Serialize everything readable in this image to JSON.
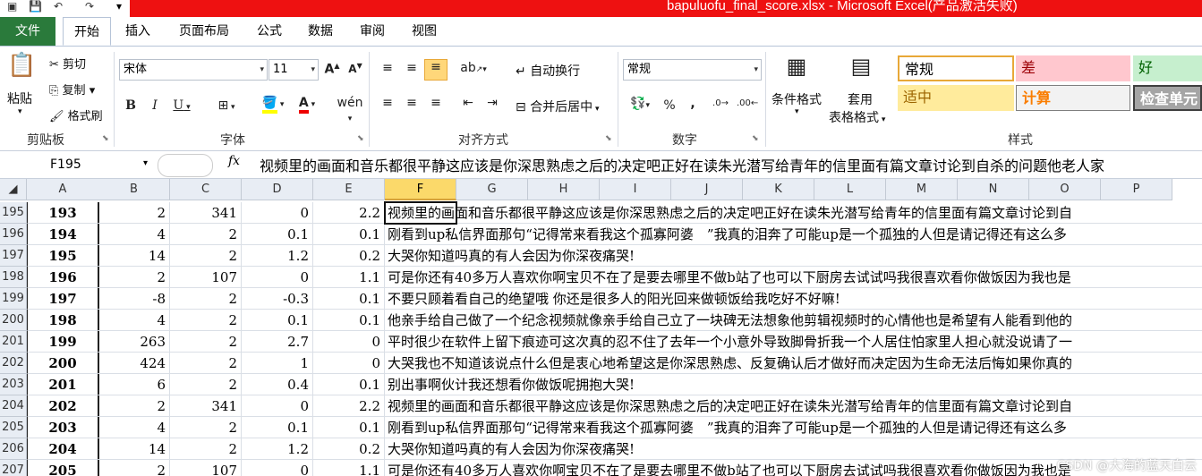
{
  "window": {
    "title": "bapuluofu_final_score.xlsx - Microsoft Excel(产品激活失败)"
  },
  "ribbon_tabs": [
    "文件",
    "开始",
    "插入",
    "页面布局",
    "公式",
    "数据",
    "审阅",
    "视图"
  ],
  "active_tab": "开始",
  "clipboard": {
    "paste": "粘贴",
    "cut": "剪切",
    "copy": "复制",
    "format_painter": "格式刷",
    "label": "剪贴板"
  },
  "font": {
    "name": "宋体",
    "size": "11",
    "label": "字体"
  },
  "alignment": {
    "wrap": "自动换行",
    "merge": "合并后居中",
    "label": "对齐方式"
  },
  "number": {
    "format": "常规",
    "percent": "%",
    "comma": ",",
    "label": "数字"
  },
  "styles": {
    "conditional": "条件格式",
    "table_format_1": "套用",
    "table_format_2": "表格格式",
    "label": "样式",
    "normal": "常规",
    "bad": "差",
    "good": "好",
    "neutral": "适中",
    "calculation": "计算",
    "check_cell": "检查单元",
    "colors": {
      "bad_bg": "#ffc7ce",
      "good_bg": "#c6efce",
      "neutral_bg": "#ffeb9c",
      "calc_text": "#fa7d00"
    }
  },
  "formula_bar": {
    "name_box": "F195",
    "fx": "fx",
    "content": "视频里的画面和音乐都很平静这应该是你深思熟虑之后的决定吧正好在读朱光潜写给青年的信里面有篇文章讨论到自杀的问题他老人家"
  },
  "columns": [
    "A",
    "B",
    "C",
    "D",
    "E",
    "F",
    "G",
    "H",
    "I",
    "J",
    "K",
    "L",
    "M",
    "N",
    "O",
    "P"
  ],
  "selected_column": "F",
  "rows": [
    {
      "rn": "195",
      "A": "193",
      "B": "2",
      "C": "341",
      "D": "0",
      "E": "2.2",
      "F": "视频里的画面和音乐都很平静这应该是你深思熟虑之后的决定吧正好在读朱光潜写给青年的信里面有篇文章讨论到自"
    },
    {
      "rn": "196",
      "A": "194",
      "B": "4",
      "C": "2",
      "D": "0.1",
      "E": "0.1",
      "F": "刚看到up私信界面那句“记得常来看我这个孤寡阿婆　”我真的泪奔了可能up是一个孤独的人但是请记得还有这么多"
    },
    {
      "rn": "197",
      "A": "195",
      "B": "14",
      "C": "2",
      "D": "1.2",
      "E": "0.2",
      "F": "大哭你知道吗真的有人会因为你深夜痛哭!"
    },
    {
      "rn": "198",
      "A": "196",
      "B": "2",
      "C": "107",
      "D": "0",
      "E": "1.1",
      "F": "可是你还有40多万人喜欢你啊宝贝不在了是要去哪里不做b站了也可以下厨房去试试吗我很喜欢看你做饭因为我也是"
    },
    {
      "rn": "199",
      "A": "197",
      "B": "-8",
      "C": "2",
      "D": "-0.3",
      "E": "0.1",
      "F": "不要只顾着看自己的绝望哦 你还是很多人的阳光回来做顿饭给我吃好不好嘛!"
    },
    {
      "rn": "200",
      "A": "198",
      "B": "4",
      "C": "2",
      "D": "0.1",
      "E": "0.1",
      "F": "他亲手给自己做了一个纪念视频就像亲手给自己立了一块碑无法想象他剪辑视频时的心情他也是希望有人能看到他的"
    },
    {
      "rn": "201",
      "A": "199",
      "B": "263",
      "C": "2",
      "D": "2.7",
      "E": "0",
      "F": "平时很少在软件上留下痕迹可这次真的忍不住了去年一个小意外导致脚骨折我一个人居住怕家里人担心就没说请了一"
    },
    {
      "rn": "202",
      "A": "200",
      "B": "424",
      "C": "2",
      "D": "1",
      "E": "0",
      "F": "大哭我也不知道该说点什么但是衷心地希望这是你深思熟虑、反复确认后才做好而决定因为生命无法后悔如果你真的"
    },
    {
      "rn": "203",
      "A": "201",
      "B": "6",
      "C": "2",
      "D": "0.4",
      "E": "0.1",
      "F": "别出事啊伙计我还想看你做饭呢拥抱大哭!"
    },
    {
      "rn": "204",
      "A": "202",
      "B": "2",
      "C": "341",
      "D": "0",
      "E": "2.2",
      "F": "视频里的画面和音乐都很平静这应该是你深思熟虑之后的决定吧正好在读朱光潜写给青年的信里面有篇文章讨论到自"
    },
    {
      "rn": "205",
      "A": "203",
      "B": "4",
      "C": "2",
      "D": "0.1",
      "E": "0.1",
      "F": "刚看到up私信界面那句“记得常来看我这个孤寡阿婆　”我真的泪奔了可能up是一个孤独的人但是请记得还有这么多"
    },
    {
      "rn": "206",
      "A": "204",
      "B": "14",
      "C": "2",
      "D": "1.2",
      "E": "0.2",
      "F": "大哭你知道吗真的有人会因为你深夜痛哭!"
    },
    {
      "rn": "207",
      "A": "205",
      "B": "2",
      "C": "107",
      "D": "0",
      "E": "1.1",
      "F": "可是你还有40多万人喜欢你啊宝贝不在了是要去哪里不做b站了也可以下厨房去试试吗我很喜欢看你做饭因为我也是"
    }
  ],
  "watermark": "CSDN @大海的蓝天白云"
}
